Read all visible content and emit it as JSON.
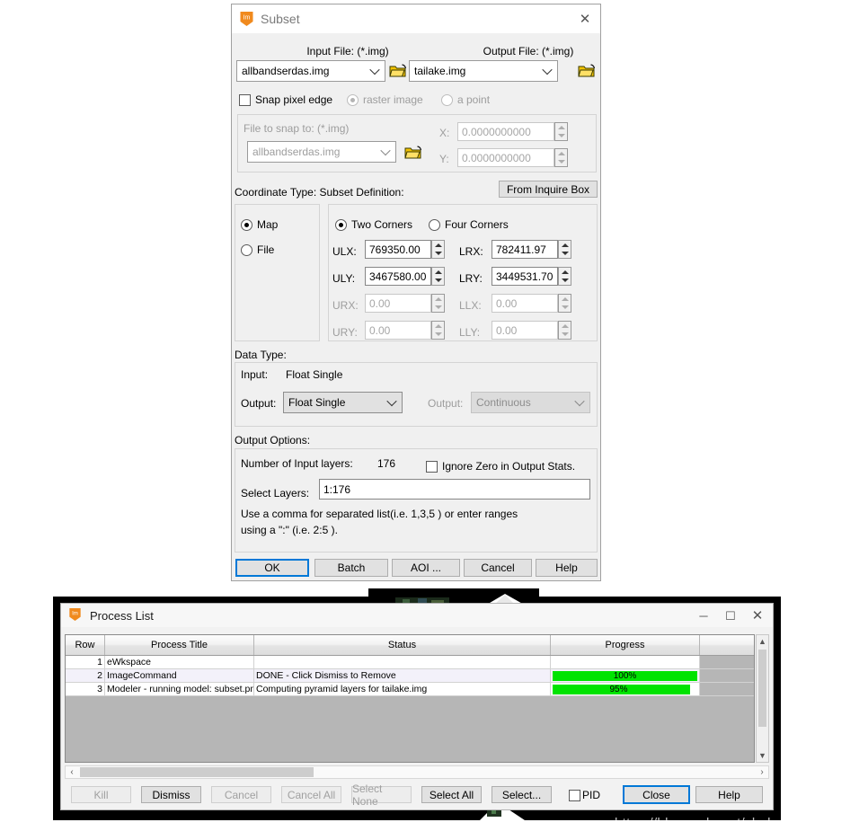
{
  "subset_window": {
    "title": "Subset",
    "icon": "erdas-imagine-icon",
    "close_label": "✕",
    "input_file": {
      "label": "Input File: (*.img)",
      "value": "allbandserdas.img",
      "browse_icon": "open-folder-icon"
    },
    "output_file": {
      "label": "Output File: (*.img)",
      "value": "tailake.img",
      "browse_icon": "open-folder-icon"
    },
    "snap": {
      "checkbox_label": "Snap pixel edge",
      "radio_raster": "raster image",
      "radio_point": "a point",
      "file_to_snap_label": "File to snap to: (*.img)",
      "file_to_snap_value": "allbandserdas.img",
      "x_label": "X:",
      "x_value": "0.0000000000",
      "y_label": "Y:",
      "y_value": "0.0000000000"
    },
    "coord_section_label": "Coordinate Type: Subset Definition:",
    "from_inquire_box": "From Inquire Box",
    "coord_type": {
      "map": "Map",
      "file": "File",
      "selected": "Map"
    },
    "corners_mode": {
      "two": "Two Corners",
      "four": "Four Corners",
      "selected": "Two Corners"
    },
    "corners": [
      {
        "label": "ULX:",
        "value": "769350.00",
        "disabled": false
      },
      {
        "label": "LRX:",
        "value": "782411.97",
        "disabled": false
      },
      {
        "label": "ULY:",
        "value": "3467580.00",
        "disabled": false
      },
      {
        "label": "LRY:",
        "value": "3449531.70",
        "disabled": false
      },
      {
        "label": "URX:",
        "value": "0.00",
        "disabled": true
      },
      {
        "label": "LLX:",
        "value": "0.00",
        "disabled": true
      },
      {
        "label": "URY:",
        "value": "0.00",
        "disabled": true
      },
      {
        "label": "LLY:",
        "value": "0.00",
        "disabled": true
      }
    ],
    "data_type": {
      "section_label": "Data Type:",
      "input_label": "Input:",
      "input_value": "Float Single",
      "output_label": "Output:",
      "output_value": "Float Single",
      "output2_label": "Output:",
      "output2_value": "Continuous"
    },
    "output_options": {
      "section_label": "Output Options:",
      "num_layers_label": "Number of Input layers:",
      "num_layers_value": "176",
      "ignore_zero_label": "Ignore Zero in Output Stats.",
      "select_layers_label": "Select Layers:",
      "select_layers_value": "1:176",
      "hint_line1": "Use a comma for separated list(i.e. 1,3,5 ) or enter ranges",
      "hint_line2": "using a \":\" (i.e. 2:5 )."
    },
    "buttons": [
      {
        "label": "OK",
        "default": true
      },
      {
        "label": "Batch",
        "default": false
      },
      {
        "label": "AOI ...",
        "default": false
      },
      {
        "label": "Cancel",
        "default": false
      },
      {
        "label": "Help",
        "default": false
      }
    ]
  },
  "process_list_window": {
    "title": "Process List",
    "icon": "erdas-imagine-icon",
    "minimize_label": "─",
    "maximize_label": "☐",
    "close_label": "✕",
    "columns": [
      "Row",
      "Process Title",
      "Status",
      "Progress",
      ""
    ],
    "rows": [
      {
        "row": "1",
        "title": "eWkspace",
        "status": "",
        "progress": "",
        "progress_pct": 0,
        "show_bar": false
      },
      {
        "row": "2",
        "title": "ImageCommand",
        "status": "DONE - Click Dismiss to Remove",
        "progress": "100%",
        "progress_pct": 100,
        "show_bar": true
      },
      {
        "row": "3",
        "title": "Modeler - running model: subset.pmdl",
        "status": "Computing pyramid layers for tailake.img",
        "progress": "95%",
        "progress_pct": 95,
        "show_bar": true
      }
    ],
    "buttons": [
      {
        "label": "Kill",
        "disabled": true,
        "default": false
      },
      {
        "label": "Dismiss",
        "disabled": false,
        "default": false
      },
      {
        "label": "Cancel",
        "disabled": true,
        "default": false
      },
      {
        "label": "Cancel All",
        "disabled": true,
        "default": false
      },
      {
        "label": "Select None",
        "disabled": true,
        "default": false
      },
      {
        "label": "Select All",
        "disabled": false,
        "default": false
      },
      {
        "label": "Select...",
        "disabled": false,
        "default": false
      },
      {
        "label": "Close",
        "disabled": false,
        "default": true
      },
      {
        "label": "Help",
        "disabled": false,
        "default": false
      }
    ],
    "pid_checkbox_label": "PID",
    "scroll_up_icon": "chevron-up-icon",
    "scroll_down_icon": "chevron-down-icon",
    "scroll_left_icon": "chevron-left-icon",
    "scroll_right_icon": "chevron-right-icon"
  },
  "watermark": "https://blog.csdn.net/zhebushibiaoshifu",
  "colors": {
    "accent": "#0078d7",
    "progress_green": "#00e300",
    "brand_orange": "#f08a1e",
    "dialog_bg": "#f0f0f0",
    "backdrop": "#000000"
  }
}
